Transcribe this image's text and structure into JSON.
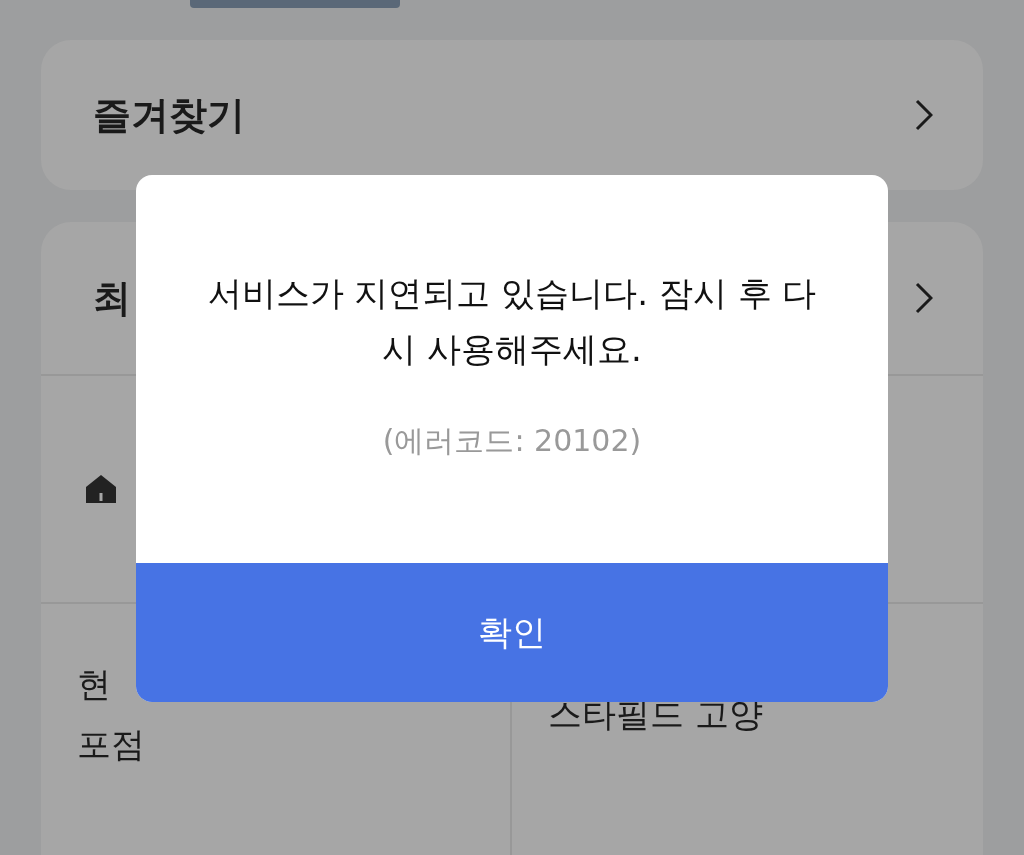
{
  "background": {
    "favorites": {
      "title": "즐겨찾기"
    },
    "recent": {
      "title": "최",
      "cells": [
        {
          "lines": [
            "현",
            "포점"
          ]
        },
        {
          "lines": [
            "스타필드 고양"
          ]
        }
      ]
    }
  },
  "dialog": {
    "message": "서비스가 지연되고 있습니다. 잠시 후 다시 사용해주세요.",
    "error_code": "(에러코드: 20102)",
    "button": "확인"
  }
}
